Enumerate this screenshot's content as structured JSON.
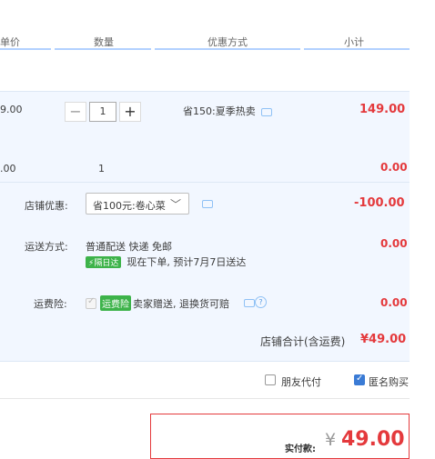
{
  "header": {
    "col_price": "单价",
    "col_qty": "数量",
    "col_promo": "优惠方式",
    "col_subtotal": "小计"
  },
  "item": {
    "price": "9.00",
    "quantity": "1",
    "promo": "省150:夏季热卖",
    "subtotal": "149.00",
    "minus": "−",
    "plus": "+"
  },
  "gift": {
    "price": ".00",
    "quantity": "1",
    "subtotal": "0.00"
  },
  "shop_discount": {
    "label": "店铺优惠:",
    "selected": "省100元:卷心菜",
    "amount": "-100.00"
  },
  "shipping": {
    "label": "运送方式:",
    "method": "普通配送 快递 免邮",
    "badge": "隔日达",
    "eta": "现在下单, 预计7月7日送达",
    "amount": "0.00"
  },
  "insurance": {
    "label": "运费险:",
    "badge": "运费险",
    "desc": "卖家赠送, 退换货可赔",
    "help": "?",
    "amount": "0.00"
  },
  "shop_total": {
    "label": "店铺合计(含运费)",
    "amount": "¥49.00"
  },
  "options": {
    "friend_pay": "朋友代付",
    "anonymous": "匿名购买"
  },
  "payment": {
    "label": "实付款:",
    "currency": "¥",
    "amount": "49.00"
  },
  "colors": {
    "accent": "#e4393c",
    "band": "#f2f7ff",
    "line": "#b2d1ff",
    "check": "#3a7bd5"
  }
}
